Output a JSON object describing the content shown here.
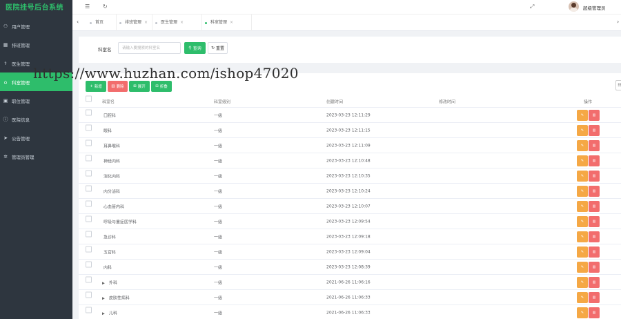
{
  "app": {
    "title": "医院挂号后台系统"
  },
  "sidebar": {
    "items": [
      {
        "label": "用户管理",
        "icon": "user-icon",
        "glyph": "⚇",
        "active": false
      },
      {
        "label": "排班管理",
        "icon": "schedule-icon",
        "glyph": "▦",
        "active": false
      },
      {
        "label": "医生管理",
        "icon": "doctor-icon",
        "glyph": "⚕",
        "active": false
      },
      {
        "label": "科室管理",
        "icon": "department-icon",
        "glyph": "⌂",
        "active": true
      },
      {
        "label": "职位管理",
        "icon": "position-icon",
        "glyph": "▣",
        "active": false
      },
      {
        "label": "医院信息",
        "icon": "info-icon",
        "glyph": "ⓘ",
        "active": false
      },
      {
        "label": "公告管理",
        "icon": "notice-icon",
        "glyph": "➤",
        "active": false
      },
      {
        "label": "管理员管理",
        "icon": "admin-icon",
        "glyph": "✲",
        "active": false
      }
    ]
  },
  "header": {
    "menu_toggle_icon": "menu-toggle-icon",
    "refresh_icon": "refresh-icon",
    "fullscreen_icon": "fullscreen-icon",
    "user_name": "超级管理员"
  },
  "tabs": [
    {
      "label": "首页",
      "closable": false,
      "active": false
    },
    {
      "label": "排班管理",
      "closable": true,
      "active": false
    },
    {
      "label": "医生管理",
      "closable": true,
      "active": false
    },
    {
      "label": "科室管理",
      "closable": true,
      "active": true
    }
  ],
  "search": {
    "label": "科室名",
    "placeholder": "请输入要搜索的科室名",
    "query_label": "查询",
    "reset_label": "重置"
  },
  "watermark": "https://www.huzhan.com/ishop47020",
  "toolbar": {
    "add_label": "新增",
    "delete_label": "删除",
    "expand_label": "展开",
    "collapse_label": "折叠",
    "colors": {
      "add": "#2ebd6b",
      "delete": "#f26d6d",
      "expand": "#2ebd6b",
      "collapse": "#2ebd6b"
    }
  },
  "table": {
    "columns": [
      "科室名",
      "科室级别",
      "创建时间",
      "修改时间",
      "操作"
    ],
    "edit_icon": "edit-icon",
    "delete_icon": "trash-icon",
    "rows": [
      {
        "name": "口腔科",
        "level": "一级",
        "created": "2023-03-23 12:11:29",
        "modified": "",
        "expandable": false
      },
      {
        "name": "眼科",
        "level": "一级",
        "created": "2023-03-23 12:11:15",
        "modified": "",
        "expandable": false
      },
      {
        "name": "耳鼻喉科",
        "level": "一级",
        "created": "2023-03-23 12:11:09",
        "modified": "",
        "expandable": false
      },
      {
        "name": "神经内科",
        "level": "一级",
        "created": "2023-03-23 12:10:48",
        "modified": "",
        "expandable": false
      },
      {
        "name": "消化内科",
        "level": "一级",
        "created": "2023-03-23 12:10:35",
        "modified": "",
        "expandable": false
      },
      {
        "name": "内分泌科",
        "level": "一级",
        "created": "2023-03-23 12:10:24",
        "modified": "",
        "expandable": false
      },
      {
        "name": "心血管内科",
        "level": "一级",
        "created": "2023-03-23 12:10:07",
        "modified": "",
        "expandable": false
      },
      {
        "name": "呼吸与重症医学科",
        "level": "一级",
        "created": "2023-03-23 12:09:54",
        "modified": "",
        "expandable": false
      },
      {
        "name": "急诊科",
        "level": "一级",
        "created": "2023-03-23 12:09:18",
        "modified": "",
        "expandable": false
      },
      {
        "name": "五官科",
        "level": "一级",
        "created": "2023-03-23 12:09:04",
        "modified": "",
        "expandable": false
      },
      {
        "name": "内科",
        "level": "一级",
        "created": "2023-03-23 12:08:39",
        "modified": "",
        "expandable": false
      },
      {
        "name": "外科",
        "level": "一级",
        "created": "2021-06-26 11:06:16",
        "modified": "",
        "expandable": true
      },
      {
        "name": "皮肤性病科",
        "level": "一级",
        "created": "2021-06-26 11:06:33",
        "modified": "",
        "expandable": true
      },
      {
        "name": "儿科",
        "level": "一级",
        "created": "2021-06-26 11:06:33",
        "modified": "",
        "expandable": true
      }
    ]
  }
}
